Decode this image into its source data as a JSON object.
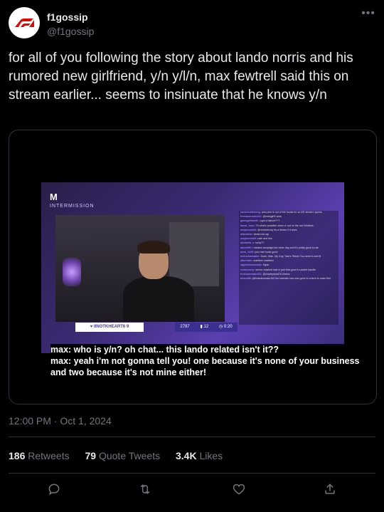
{
  "tweet": {
    "display_name": "f1gossip",
    "handle": "@f1gossip",
    "text": "for all of you following the story about lando norris and his rumored new girlfriend, y/n y/l/n, max fewtrell said this on stream earlier... seems to insinuate that he knows y/n",
    "timestamp": "12:00 PM · Oct 1, 2024",
    "stats": {
      "retweets_count": "186",
      "retweets_label": "Retweets",
      "quotes_count": "79",
      "quotes_label": "Quote Tweets",
      "likes_count": "3.4K",
      "likes_label": "Likes"
    }
  },
  "media": {
    "stream_logo": "M",
    "stream_title": "INTERMISSION",
    "gift_banner": "♥ IINOTKHEART6 9",
    "viewer_stat": "2787",
    "clip_stat": "12",
    "clip_time": "0:20",
    "subtitle_line1": "max: who is y/n? oh chat... this lando related isn't it??",
    "subtitle_line2": "max: yeah i'm not gonna tell you! one because it's none of your business and two because it's not mine either!",
    "chat": [
      {
        "user": "nanidoshitelong:",
        "msg": "pew pew is out of the books for an M1 stream i guess"
      },
      {
        "user": "freshanecado162:",
        "msg": "@missgirlS wow"
      },
      {
        "user": "gamegirlnani8:",
        "msg": "u got a haircut???"
      },
      {
        "user": "lamar_buzz:",
        "msg": "Th what's possible since ur out on the run! Morbius."
      },
      {
        "user": "mayboomkill:",
        "msg": "@mmfurloney its a dream if it does"
      },
      {
        "user": "alibeamst:",
        "msg": "kinda mid ngl"
      },
      {
        "user": "mayboomkill:",
        "msg": "cate and him"
      },
      {
        "user": "alicianila_x:",
        "msg": "turby??"
      },
      {
        "user": "alicel996:",
        "msg": "i started campaign the other day and it's pretty good so far"
      },
      {
        "user": "mew_1199:",
        "msg": "your hair looks good"
      },
      {
        "user": "hmhmhmnaalie:",
        "msg": "Dude, Man. My Guy. Tato's Tiktok! You need to see it!"
      },
      {
        "user": "aiberitatv:",
        "msg": "marbles! marbles!"
      },
      {
        "user": "sgtpinklemonade:",
        "msg": "biyou"
      },
      {
        "user": "rnskeczezy:",
        "msg": "server crashed sad or just that good it couldnt handle"
      },
      {
        "user": "freshanecado162:",
        "msg": "@charleyboat78 cheers"
      },
      {
        "user": "ariavd88:",
        "msg": "@freshanecado162 the hamster has now gone to a farm to roam free"
      }
    ]
  },
  "colors": {
    "background": "#000000",
    "text": "#e7e9ea",
    "muted": "#71767b",
    "border": "#2f3336",
    "f1_red": "#e10600"
  },
  "icons": {
    "reply": "reply-icon",
    "retweet": "retweet-icon",
    "like": "heart-icon",
    "share": "share-icon",
    "more": "more-icon",
    "logo": "f1-logo-icon"
  }
}
